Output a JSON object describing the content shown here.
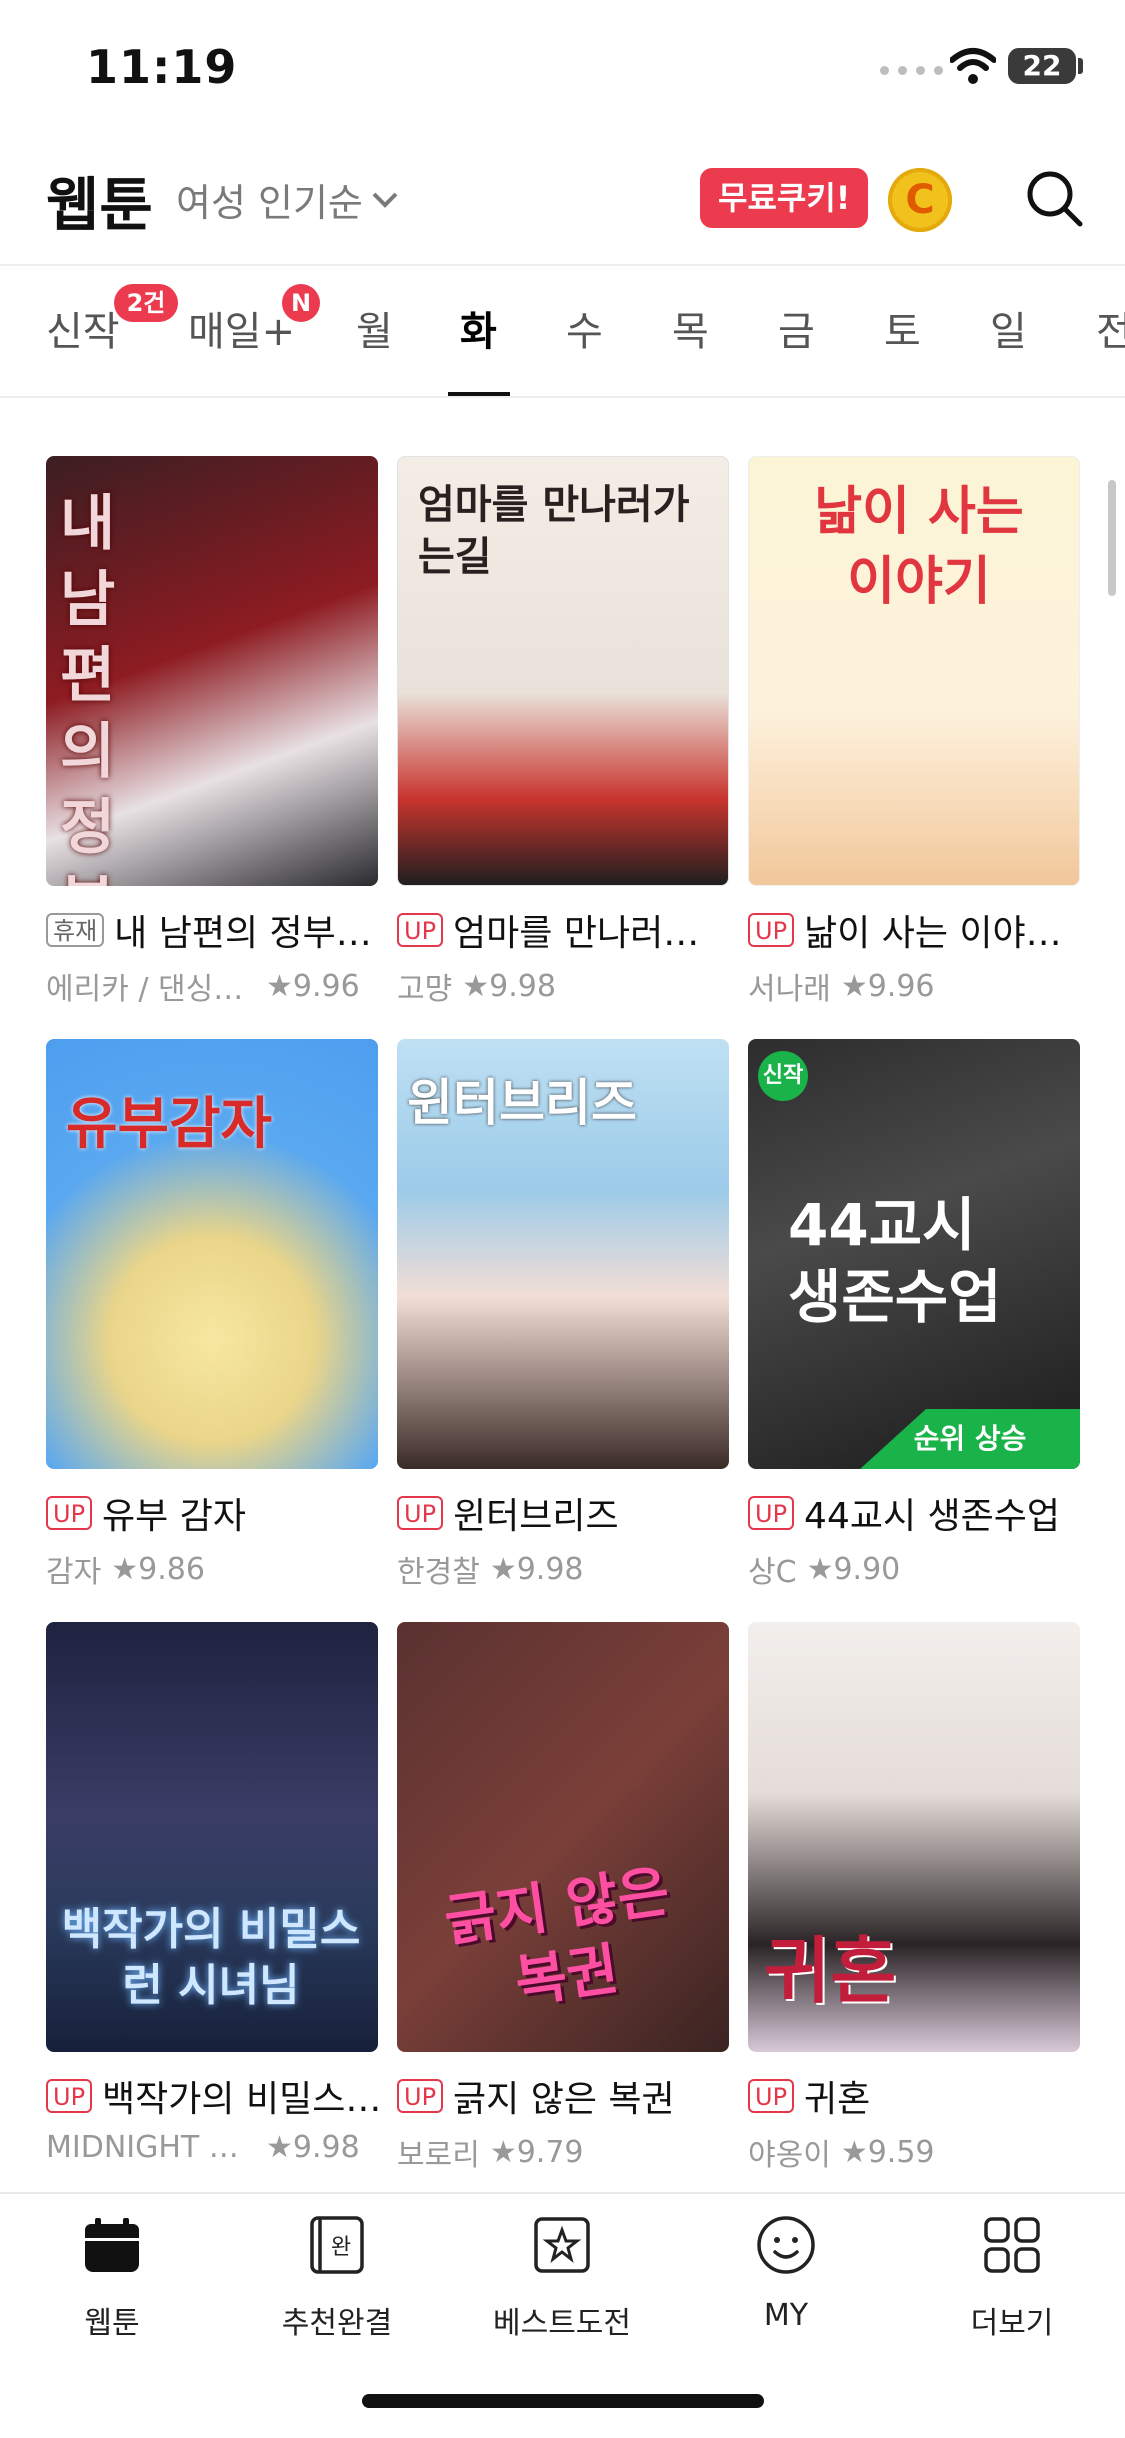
{
  "status": {
    "time": "11:19",
    "battery": "22"
  },
  "header": {
    "title": "웹툰",
    "sort_label": "여성 인기순",
    "cookie_label": "무료쿠키!",
    "coin_letter": "C"
  },
  "tabs": [
    {
      "label": "신작",
      "badge": "2건"
    },
    {
      "label": "매일+",
      "badge": "N"
    },
    {
      "label": "월"
    },
    {
      "label": "화",
      "active": true
    },
    {
      "label": "수"
    },
    {
      "label": "목"
    },
    {
      "label": "금"
    },
    {
      "label": "토"
    },
    {
      "label": "일"
    },
    {
      "label": "전"
    }
  ],
  "cards": [
    {
      "tag": "휴재",
      "title": "내 남편의 정부…",
      "author": "에리카 / 댄싱브…",
      "rating": "9.96",
      "cover_text": "내 남편의 정부에게",
      "new_badge": "",
      "rank_badge": ""
    },
    {
      "tag": "UP",
      "title": "엄마를 만나러…",
      "author": "고먕",
      "rating": "9.98",
      "cover_text": "엄마를 만나러가는길",
      "new_badge": "",
      "rank_badge": ""
    },
    {
      "tag": "UP",
      "title": "낢이 사는 이야…",
      "author": "서나래",
      "rating": "9.96",
      "cover_text": "낢이 사는 이야기",
      "new_badge": "",
      "rank_badge": ""
    },
    {
      "tag": "UP",
      "title": "유부 감자",
      "author": "감자",
      "rating": "9.86",
      "cover_text": "유부감자",
      "new_badge": "",
      "rank_badge": ""
    },
    {
      "tag": "UP",
      "title": "윈터브리즈",
      "author": "한경찰",
      "rating": "9.98",
      "cover_text": "윈터브리즈",
      "new_badge": "",
      "rank_badge": ""
    },
    {
      "tag": "UP",
      "title": "44교시 생존수업",
      "author": "상C",
      "rating": "9.90",
      "cover_text": "44교시 생존수업",
      "new_badge": "신작",
      "rank_badge": "순위 상승"
    },
    {
      "tag": "UP",
      "title": "백작가의 비밀스…",
      "author": "MIDNIGHT S…",
      "rating": "9.98",
      "cover_text": "백작가의 비밀스런 시녀님",
      "new_badge": "",
      "rank_badge": ""
    },
    {
      "tag": "UP",
      "title": "긁지 않은 복권",
      "author": "보로리",
      "rating": "9.79",
      "cover_text": "긁지 않은 복권",
      "new_badge": "",
      "rank_badge": ""
    },
    {
      "tag": "UP",
      "title": "귀혼",
      "author": "야옹이",
      "rating": "9.59",
      "cover_text": "귀혼",
      "new_badge": "",
      "rank_badge": ""
    }
  ],
  "nav": [
    {
      "label": "웹툰",
      "icon": "calendar-icon"
    },
    {
      "label": "추천완결",
      "icon": "complete-book-icon"
    },
    {
      "label": "베스트도전",
      "icon": "star-box-icon"
    },
    {
      "label": "MY",
      "icon": "smile-icon"
    },
    {
      "label": "더보기",
      "icon": "grid-icon"
    }
  ],
  "colors": {
    "accent": "#ec3a4f",
    "coin": "#f1c21b"
  }
}
